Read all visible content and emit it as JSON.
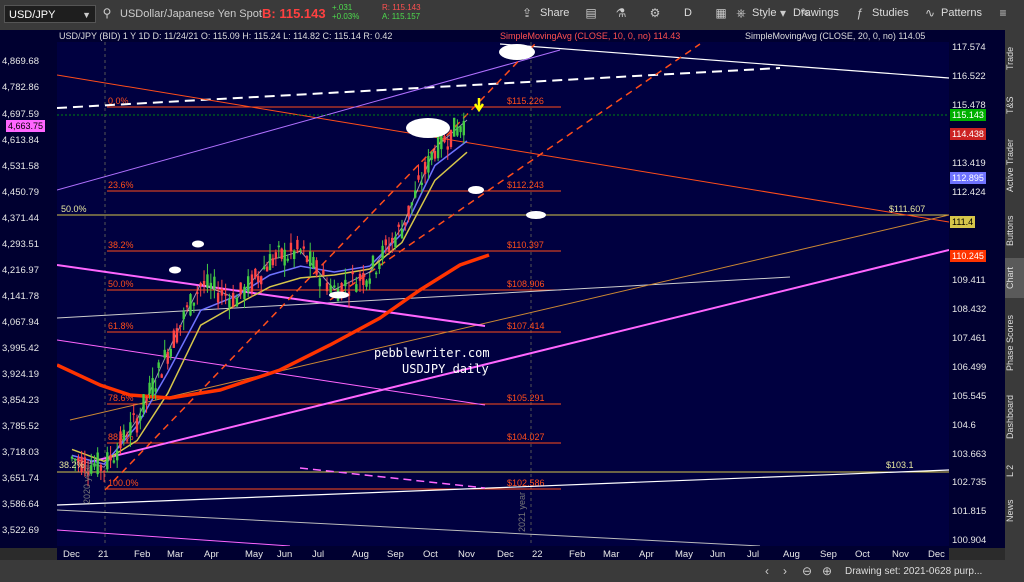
{
  "toolbar": {
    "symbol": "USD/JPY",
    "description": "USDollar/Japanese Yen Spot",
    "bid": "B: 115.143",
    "change_top": "+.031",
    "change_pct": "+0.03%",
    "ask_label": "R: 115.143",
    "ask_label2": "A: 115.157",
    "share": "Share",
    "d": "D",
    "style": "Style",
    "drawings": "Drawings",
    "studies": "Studies",
    "patterns": "Patterns"
  },
  "header": {
    "ohlc": "USD/JPY (BID)  1 Y 1D   D: 11/24/21   O: 115.09   H: 115.24   L: 114.82   C: 115.14   R: 0.42",
    "sma10": "SimpleMovingAvg (CLOSE, 10, 0, no)  114.43",
    "sma20": "SimpleMovingAvg (CLOSE, 20, 0, no)  114.05"
  },
  "colors": {
    "background": "#000040",
    "fib": "#ff4d1a",
    "sma_red": "#ff3300",
    "sma_blue": "#6f73ff",
    "sma_yellow": "#d6c64a",
    "magenta": "#ff66ff",
    "white": "#ffffff",
    "candle_up": "#44cc44",
    "candle_down": "#ff4444"
  },
  "left_axis": [
    "4,869.68",
    "4,782.86",
    "4,697.59",
    "4,613.84",
    "4,531.58",
    "4,450.79",
    "4,371.44",
    "4,293.51",
    "4,216.97",
    "4,141.78",
    "4,067.94",
    "3,995.42",
    "3,924.19",
    "3,854.23",
    "3,785.52",
    "3,718.03",
    "3,651.74",
    "3,586.64",
    "3,522.69"
  ],
  "left_tag": "4,663.75",
  "right_axis": [
    "117.574",
    "116.522",
    "115.478",
    "114.43",
    "113.419",
    "112.424",
    "110.24",
    "109.411",
    "108.432",
    "107.461",
    "106.499",
    "105.545",
    "104.6",
    "103.663",
    "102.735",
    "101.815",
    "100.904"
  ],
  "right_tags": {
    "last": "115.143",
    "sma10": "114.438",
    "sma_blue": "112.895",
    "yellow": "111.4",
    "red": "110.245"
  },
  "x_axis": [
    "Dec",
    "21",
    "Feb",
    "Mar",
    "Apr",
    "May",
    "Jun",
    "Jul",
    "Aug",
    "Sep",
    "Oct",
    "Nov",
    "Dec",
    "22",
    "Feb",
    "Mar",
    "Apr",
    "May",
    "Jun",
    "Jul",
    "Aug",
    "Sep",
    "Oct",
    "Nov",
    "Dec"
  ],
  "annotations": {
    "watermark1": "pebblewriter.com",
    "watermark2": "USDJPY daily",
    "year2020": "2020 year",
    "year2021": "2021 year",
    "fifty": "50.0%",
    "fifty_price": "$111.607",
    "yellow_line_price": "$103.1",
    "yellow_pct": "38.2%"
  },
  "chart_data": {
    "type": "line",
    "title": "USD/JPY (BID) 1 Y 1D",
    "x": [
      "Dec",
      "21",
      "Feb",
      "Mar",
      "Apr",
      "May",
      "Jun",
      "Jul",
      "Aug",
      "Sep",
      "Oct",
      "Nov"
    ],
    "series": [
      {
        "name": "USD/JPY close",
        "values": [
          103.7,
          103.4,
          105.0,
          107.3,
          109.6,
          109.1,
          110.4,
          110.7,
          109.4,
          110.0,
          111.5,
          114.2,
          115.14
        ]
      },
      {
        "name": "SimpleMovingAvg (CLOSE, 10, 0, no)",
        "values": [
          103.8,
          103.5,
          104.8,
          106.6,
          108.7,
          109.2,
          109.9,
          110.2,
          110.0,
          110.2,
          111.3,
          113.6,
          114.43
        ]
      },
      {
        "name": "SimpleMovingAvg (CLOSE, 20, 0, no)",
        "values": [
          104.0,
          103.6,
          104.3,
          105.9,
          108.2,
          108.9,
          109.5,
          109.8,
          109.9,
          110.1,
          111.0,
          113.1,
          114.05
        ]
      }
    ],
    "fib_levels": [
      {
        "pct": "0.0%",
        "price": "$115.226"
      },
      {
        "pct": "23.6%",
        "price": "$112.243"
      },
      {
        "pct": "38.2%",
        "price": "$110.397"
      },
      {
        "pct": "50.0%",
        "price": "$108.906"
      },
      {
        "pct": "61.8%",
        "price": "$107.414"
      },
      {
        "pct": "78.6%",
        "price": "$105.291"
      },
      {
        "pct": "88.6%",
        "price": "$104.027"
      },
      {
        "pct": "100.0%",
        "price": "$102.586"
      }
    ],
    "ylim_right": [
      100.4,
      118.2
    ]
  },
  "sidebar": [
    "Trade",
    "T&S",
    "Active Trader",
    "Buttons",
    "Chart",
    "Phase Scores",
    "Dashboard",
    "L 2",
    "News"
  ],
  "bottom": {
    "drawing_set": "Drawing set: 2021-0628 purp..."
  }
}
